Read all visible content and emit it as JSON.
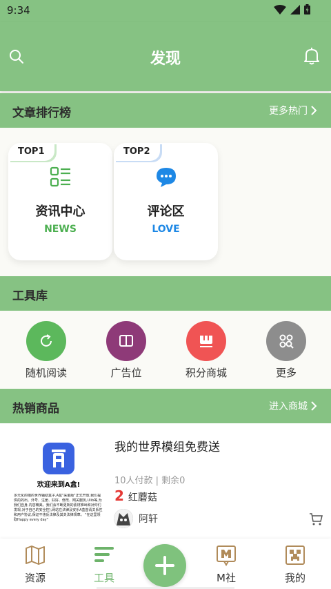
{
  "status": {
    "time": "9:34"
  },
  "appbar": {
    "title": "发现"
  },
  "ranking": {
    "title": "文章排行榜",
    "more": "更多热门",
    "cards": [
      {
        "badge": "TOP1",
        "name": "资讯中心",
        "sub": "NEWS",
        "color": "#4caf50",
        "icon": "list-icon"
      },
      {
        "badge": "TOP2",
        "name": "评论区",
        "sub": "LOVE",
        "color": "#1e88e5",
        "icon": "chat-bubble-icon"
      }
    ]
  },
  "tools": {
    "title": "工具库",
    "items": [
      {
        "label": "随机阅读",
        "color": "#5cb85c",
        "icon": "refresh-icon"
      },
      {
        "label": "广告位",
        "color": "#8e3a78",
        "icon": "book-icon"
      },
      {
        "label": "积分商城",
        "color": "#f05454",
        "icon": "shop-icon"
      },
      {
        "label": "更多",
        "color": "#8d8d8d",
        "icon": "grid-search-icon"
      }
    ]
  },
  "hot": {
    "title": "热销商品",
    "more": "进入商城",
    "product": {
      "title": "我的世界模组免费送",
      "thumb_welcome": "欢迎来到A盒!",
      "thumb_desc": "多元化的咖的世界辅助盒子,A盒\"采金版\"正式开放,我们提供的的出、外号、注册、好好、修改、网关服务,Ulib等,为我们自身,内容精美。我们会不断更新的素材推出和对你们发现,对于自己的安全控),网站在法律及安乐A盒首请关系性和用户协议,保证不违反法律及其关法律规章。 \"在这里领取Happy every day\"",
      "meta": "10人付款 | 剩余0",
      "price": "2",
      "unit": "红蘑菇",
      "seller": "阿轩"
    }
  },
  "nav": {
    "items": [
      {
        "label": "资源",
        "icon": "map-icon"
      },
      {
        "label": "工具",
        "icon": "tool-lines-icon"
      },
      {
        "label": "M社",
        "icon": "m-community-icon"
      },
      {
        "label": "我的",
        "icon": "creeper-face-icon"
      }
    ]
  }
}
